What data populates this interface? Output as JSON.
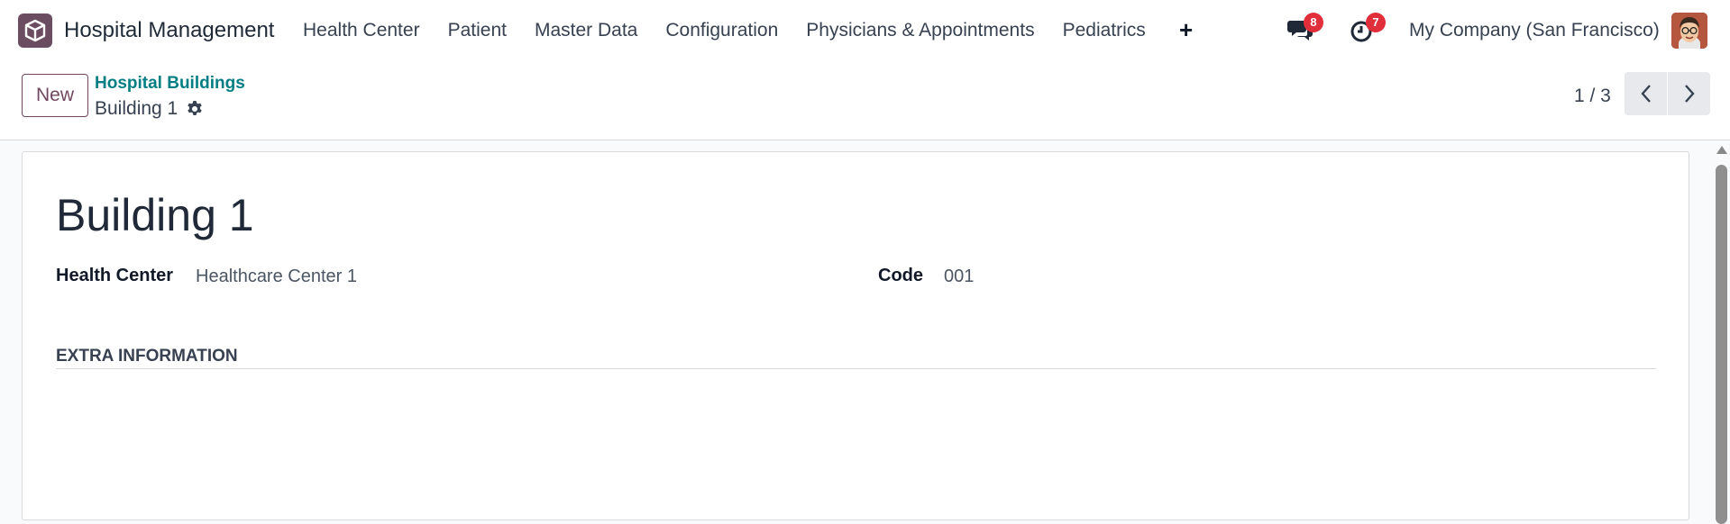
{
  "navbar": {
    "app_name": "Hospital Management",
    "menu": [
      "Health Center",
      "Patient",
      "Master Data",
      "Configuration",
      "Physicians & Appointments",
      "Pediatrics"
    ],
    "messages_badge": "8",
    "activities_badge": "7",
    "company": "My Company (San Francisco)",
    "icons": [
      "app-icon",
      "plus-icon",
      "messages-icon",
      "activity-clock-icon",
      "avatar"
    ]
  },
  "control_panel": {
    "new_label": "New",
    "breadcrumb_parent": "Hospital Buildings",
    "breadcrumb_current": "Building 1",
    "pager_value": "1 / 3"
  },
  "form": {
    "title": "Building 1",
    "health_center_label": "Health Center",
    "health_center_value": "Healthcare Center 1",
    "code_label": "Code",
    "code_value": "001",
    "section_title": "EXTRA INFORMATION"
  },
  "colors": {
    "brand": "#71475f",
    "link": "#017e84",
    "badge": "#e02f3a"
  }
}
